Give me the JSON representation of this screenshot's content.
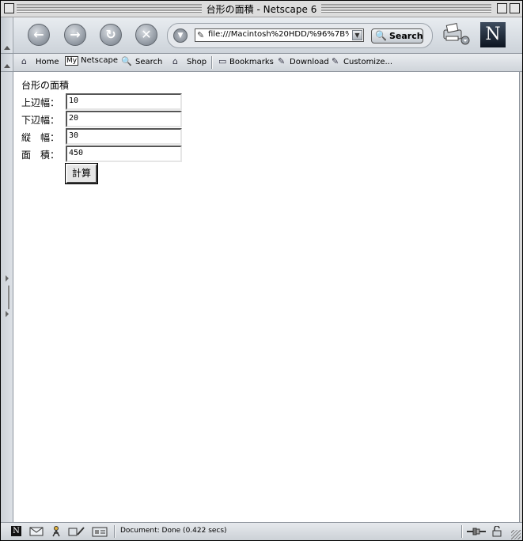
{
  "window": {
    "title": "台形の面積 - Netscape 6"
  },
  "nav": {
    "back_glyph": "←",
    "forward_glyph": "→",
    "reload_glyph": "↻",
    "stop_glyph": "✕",
    "url": "file:///Macintosh%20HDD/%96%7B%",
    "search_label": "Search"
  },
  "personal_toolbar": {
    "home": "Home",
    "my_badge": "My",
    "netscape": "Netscape",
    "search": "Search",
    "shop": "Shop",
    "bookmarks": "Bookmarks",
    "download": "Download",
    "customize": "Customize..."
  },
  "page": {
    "heading": "台形の面積",
    "fields": [
      {
        "label": "上辺幅：",
        "value": "10"
      },
      {
        "label": "下辺幅：",
        "value": "20"
      },
      {
        "label": "縦　幅：",
        "value": "30"
      },
      {
        "label": "面　積：",
        "value": "450"
      }
    ],
    "calc_button": "計算"
  },
  "status": {
    "text": "Document: Done (0.422 secs)"
  },
  "icons": {
    "netscape_logo": "N"
  }
}
